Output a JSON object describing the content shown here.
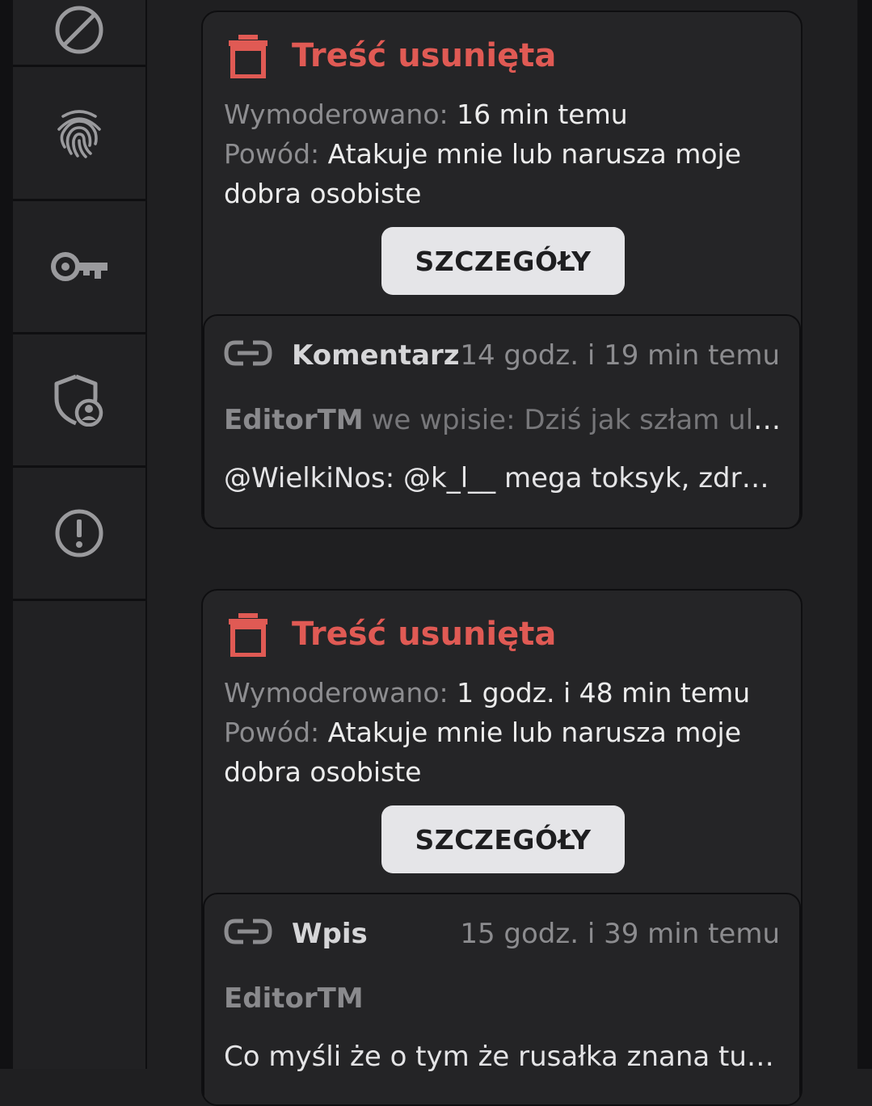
{
  "sidebar": {
    "items": [
      {
        "icon": "block-icon"
      },
      {
        "icon": "fingerprint-icon"
      },
      {
        "icon": "key-icon"
      },
      {
        "icon": "shield-person-icon"
      },
      {
        "icon": "alert-circle-icon"
      }
    ]
  },
  "colors": {
    "accent_red": "#e05a54",
    "background": "#1f1f21",
    "card": "#252527",
    "button": "#e5e5e8"
  },
  "cards": [
    {
      "title": "Treść usunięta",
      "moderated_label": "Wymoderowano:",
      "moderated_value": "16 min temu",
      "reason_label": "Powód:",
      "reason_value": "Atakuje mnie lub narusza moje dobra osobiste",
      "button": "SZCZEGÓŁY",
      "ref": {
        "type": "Komentarz",
        "time": "14 godz. i 19 min temu",
        "author": "EditorTM",
        "where": "we wpisie: Dziś jak szłam ulic...",
        "text": "@WielkiNos: @k_l__ mega toksyk, zdrad..."
      }
    },
    {
      "title": "Treść usunięta",
      "moderated_label": "Wymoderowano:",
      "moderated_value": "1 godz. i 48 min temu",
      "reason_label": "Powód:",
      "reason_value": "Atakuje mnie lub narusza moje dobra osobiste",
      "button": "SZCZEGÓŁY",
      "ref": {
        "type": "Wpis",
        "time": "15 godz. i 39 min temu",
        "author": "EditorTM",
        "text": "Co myśli że o tym że rusałka znana tu t..."
      }
    }
  ]
}
